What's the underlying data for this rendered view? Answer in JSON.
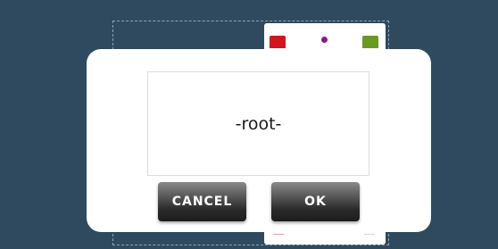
{
  "dialog": {
    "field_value": "-root-",
    "cancel_label": "CANCEL",
    "ok_label": "OK"
  },
  "colors": {
    "background": "#2f4a5e",
    "swatch_red": "#d0161c",
    "swatch_green": "#6a9a22",
    "dot_purple": "#8a1a8a"
  }
}
